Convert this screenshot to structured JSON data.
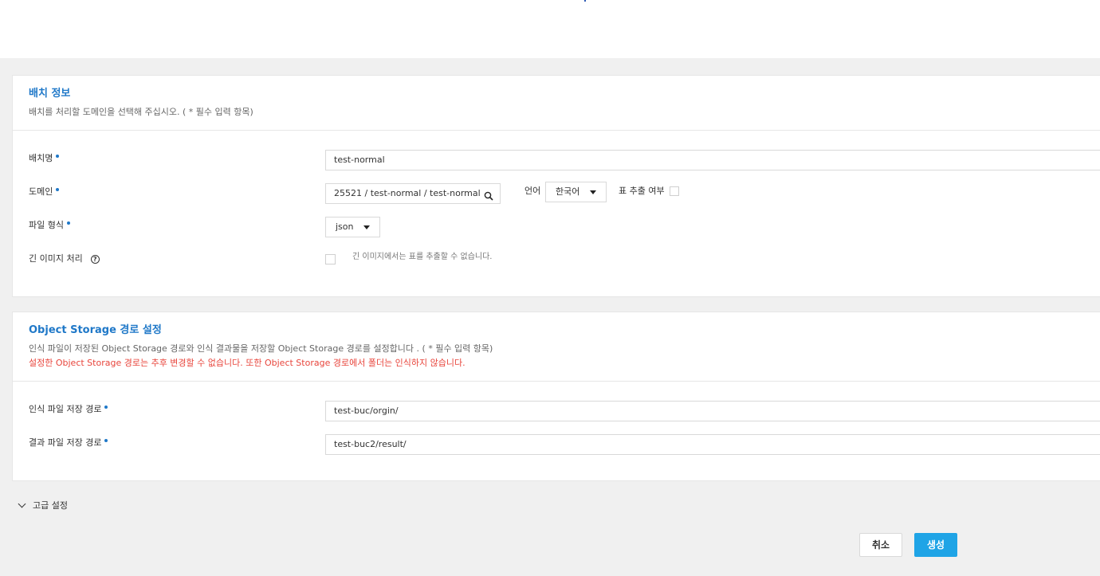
{
  "batch_info": {
    "title": "배치 정보",
    "description": "배치를 처리할 도메인을 선택해 주십시오. ( * 필수 입력 항목)",
    "name_label": "배치명",
    "name_value": "test-normal",
    "domain_label": "도메인",
    "domain_value": "25521 / test-normal / test-normal",
    "language_label": "언어",
    "language_value": "한국어",
    "table_extract_label": "표 추출 여부",
    "file_format_label": "파일 형식",
    "file_format_value": "json",
    "long_image_label": "긴 이미지 처리",
    "long_image_hint": "긴 이미지에서는 표를 추출할 수 없습니다."
  },
  "storage": {
    "title": "Object Storage 경로 설정",
    "description": "인식 파일이 저장된 Object Storage 경로와 인식 결과물을 저장할 Object Storage 경로를 설정합니다 . ( * 필수 입력 항목)",
    "warning": "설정한 Object Storage 경로는 추후 변경할 수 없습니다. 또한 Object Storage 경로에서 폴더는 인식하지 않습니다.",
    "input_path_label": "인식 파일 저장 경로",
    "input_path_value": "test-buc/orgin/",
    "output_path_label": "결과 파일 저장 경로",
    "output_path_value": "test-buc2/result/"
  },
  "advanced": {
    "label": "고급 설정"
  },
  "actions": {
    "cancel": "취소",
    "create": "생성"
  },
  "colors": {
    "accent": "#1f78c8",
    "primary_button": "#1fa4e6",
    "warning": "#e8453c"
  }
}
